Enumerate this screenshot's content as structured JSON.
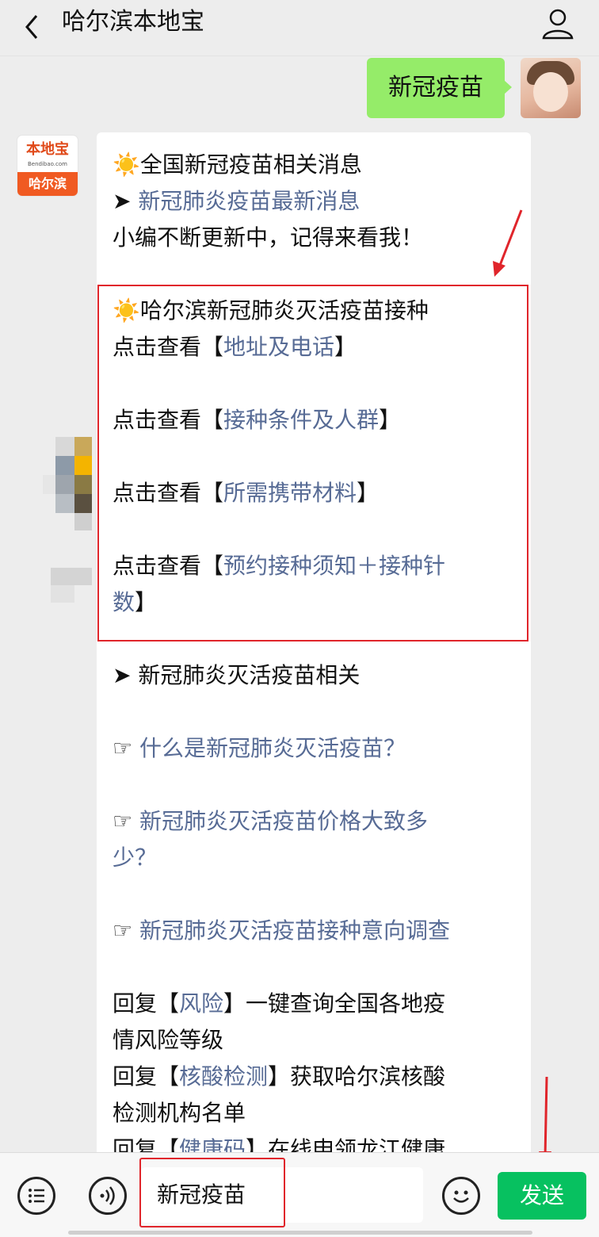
{
  "header": {
    "back_icon": "chevron-left-icon",
    "title": "哈尔滨本地宝",
    "profile_icon": "person-icon"
  },
  "sent": {
    "text": "新冠疫苗"
  },
  "bot": {
    "avatar": {
      "logo_text": "本地宝",
      "logo_sub": "Bendibao.com",
      "city": "哈尔滨"
    },
    "lines": [
      {
        "prefix": "☀️",
        "text": "全国新冠疫苗相关消息",
        "link": ""
      },
      {
        "prefix": "➤ ",
        "text": "",
        "link": "新冠肺炎疫苗最新消息"
      },
      {
        "prefix": "",
        "text": "小编不断更新中，记得来看我！",
        "link": ""
      }
    ],
    "box": {
      "heading": "哈尔滨新冠肺炎灭活疫苗接种",
      "items": [
        {
          "before": "点击查看【",
          "link": "地址及电话",
          "after": "】"
        },
        {
          "before": "点击查看【",
          "link": "接种条件及人群",
          "after": "】"
        },
        {
          "before": "点击查看【",
          "link": "所需携带材料",
          "after": "】"
        },
        {
          "before": "点击查看【",
          "link": "预约接种须知＋接种针",
          "link2": "数",
          "after": "】"
        }
      ]
    },
    "related_title": "➤ 新冠肺炎灭活疫苗相关",
    "related": [
      {
        "prefix": "☞ ",
        "link": "什么是新冠肺炎灭活疫苗？"
      },
      {
        "prefix": "☞ ",
        "link": "新冠肺炎灭活疫苗价格大致多",
        "link2": "少？"
      },
      {
        "prefix": "☞ ",
        "link": "新冠肺炎灭活疫苗接种意向调查"
      }
    ],
    "replies": [
      {
        "before": "回复【",
        "link": "风险",
        "after": "】一键查询全国各地疫",
        "line2": "情风险等级"
      },
      {
        "before": "回复【",
        "link": "核酸检测",
        "after": "】获取哈尔滨核酸",
        "line2": "检测机构名单"
      },
      {
        "before": "回复【",
        "link": "健康码",
        "after": "】在线申领龙江健康"
      }
    ]
  },
  "input_bar": {
    "menu_icon": "list-menu-icon",
    "voice_icon": "voice-icon",
    "input_value": "新冠疫苗",
    "emoji_icon": "emoji-icon",
    "send_label": "发送"
  },
  "colors": {
    "link": "#576b95",
    "send": "#07c160",
    "sent_bubble": "#95ec69",
    "highlight": "#e0252b"
  }
}
